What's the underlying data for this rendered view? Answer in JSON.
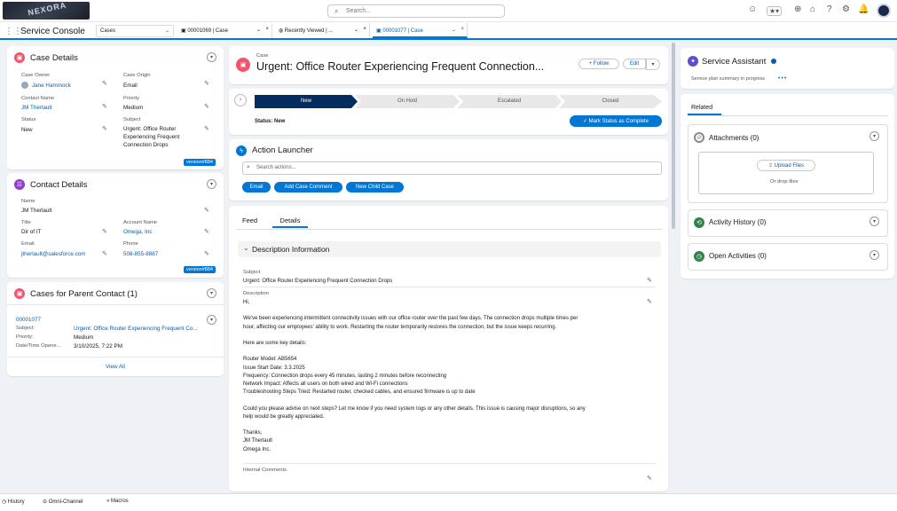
{
  "header": {
    "logo_text": "NEXORA",
    "search_placeholder": "Search...",
    "icons": [
      "assistant-icon",
      "favorites-icon",
      "add-icon",
      "home-icon",
      "help-icon",
      "setup-icon",
      "notifications-icon",
      "avatar"
    ]
  },
  "nav": {
    "app_name": "Service Console",
    "object_select": "Cases",
    "tabs": [
      {
        "label": "00001069 | Case",
        "active": false
      },
      {
        "label": "Recently Viewed | ...",
        "active": false
      },
      {
        "label": "00001077 | Case",
        "active": true
      }
    ]
  },
  "case_details": {
    "title": "Case Details",
    "case_owner_label": "Case Owner",
    "case_owner": "Jane Hammock",
    "case_origin_label": "Case Origin",
    "case_origin": "Email",
    "contact_name_label": "Contact Name",
    "contact_name": "JM Therlault",
    "priority_label": "Priority",
    "priority": "Medium",
    "status_label": "Status",
    "status": "New",
    "subject_label": "Subject",
    "subject_lines": [
      "Urgent: Office Router",
      "Experiencing Frequent",
      "Connection Drops"
    ],
    "version_badge": "version#884"
  },
  "contact_details": {
    "title": "Contact Details",
    "name_label": "Name",
    "name": "JM Therlault",
    "title_label": "Title",
    "title_value": "Dir of IT",
    "account_label": "Account Name",
    "account": "Omega, Inc",
    "email_label": "Email",
    "email": "jtherlault@salesforce.com",
    "phone_label": "Phone",
    "phone": "508-855-8887",
    "version_badge": "version#884"
  },
  "parent_cases": {
    "title": "Cases for Parent Contact (1)",
    "case_number": "00001077",
    "subject_label": "Subject:",
    "subject": "Urgent: Office Router Experiencing Frequent Co...",
    "priority_label": "Priority:",
    "priority": "Medium",
    "opened_label": "Date/Time Opene...",
    "opened": "3/10/2025, 7:22 PM",
    "view_all": "View All"
  },
  "case_header": {
    "object": "Case",
    "title": "Urgent: Office Router Experiencing Frequent Connection...",
    "follow": "Follow",
    "edit": "Edit"
  },
  "path": {
    "steps": [
      "New",
      "On Hold",
      "Escalated",
      "Closed"
    ],
    "status_text": "Status: New",
    "mark_complete": "Mark Status as Complete"
  },
  "action_launcher": {
    "title": "Action Launcher",
    "search_placeholder": "Search actions...",
    "buttons": [
      "Email",
      "Add Case Comment",
      "New Child Case"
    ]
  },
  "detail_tabs": {
    "feed": "Feed",
    "details": "Details"
  },
  "description": {
    "section_title": "Description Information",
    "subject_label": "Subject",
    "subject": "Urgent: Office Router Experiencing Frequent Connection Drops",
    "description_label": "Description",
    "lines": [
      "Hi,",
      "",
      "We've been experiencing intermittent connectivity issues with our office router over the past few days. The connection drops multiple times per",
      "hour, affecting our employees' ability to work. Restarting the router temporarily restores the connection, but the issue keeps recurring.",
      "",
      "Here are some key details:",
      "",
      "Router Model: AB5654",
      "Issue Start Date: 3.3.2025",
      "Frequency: Connection drops every 45 minutes, lasting 2 minutes before reconnecting",
      "Network Impact: Affects all users on both wired and Wi-Fi connections",
      "Troubleshooting Steps Tried: Restarted router, checked cables, and ensured firmware is up to date",
      "",
      "Could you please advise on next steps? Let me know if you need system logs or any other details. This issue is causing major disruptions, so any",
      "help would be greatly appreciated.",
      "",
      "Thanks,",
      "JM Therlault",
      "Omega Inc."
    ],
    "internal_comments_label": "Internal Comments"
  },
  "service_assistant": {
    "title": "Service Assistant",
    "progress_text": "Service plan summary in progress"
  },
  "related": {
    "tab": "Related",
    "attachments": "Attachments (0)",
    "upload": "Upload Files",
    "drop": "Or drop files",
    "activity_history": "Activity History (0)",
    "open_activities": "Open Activities (0)"
  },
  "utility_bar": {
    "items": [
      "History",
      "Omni-Channel",
      "Macros"
    ]
  },
  "colors": {
    "brand_blue": "#0176d3",
    "path_active": "#032d60",
    "case_icon": "#f2536d",
    "contact_icon": "#8a3ec9",
    "activity_icon": "#2e844a"
  }
}
